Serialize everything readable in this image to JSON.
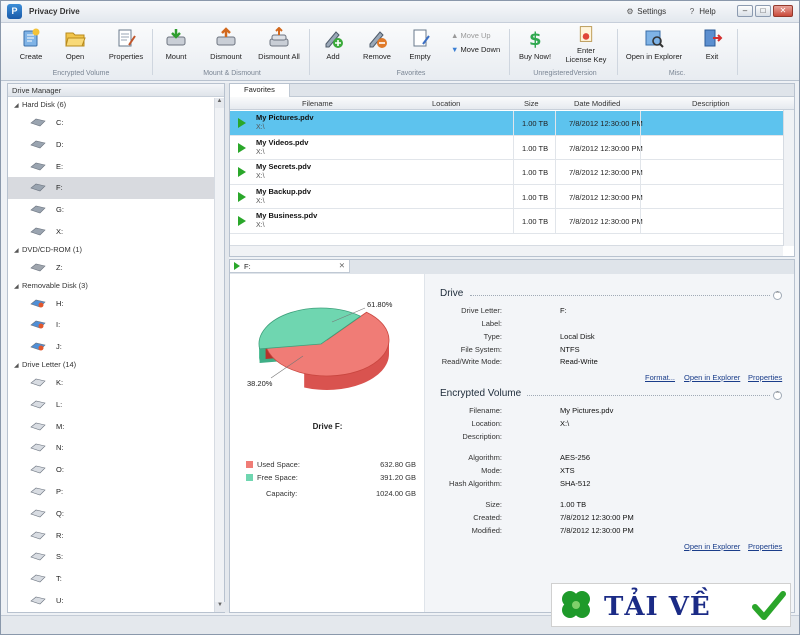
{
  "app": {
    "title": "Privacy Drive",
    "logo_letter": "P",
    "settings_label": "Settings",
    "help_label": "Help"
  },
  "ribbon": {
    "create": "Create",
    "open": "Open",
    "properties": "Properties",
    "group_encrypted": "Encrypted Volume",
    "mount": "Mount",
    "dismount": "Dismount",
    "dismount_all": "Dismount All",
    "group_mount": "Mount & Dismount",
    "add": "Add",
    "remove": "Remove",
    "empty": "Empty",
    "move_up": "Move Up",
    "move_down": "Move Down",
    "group_favorites": "Favorites",
    "buy_now": "Buy Now!",
    "enter_license_1": "Enter",
    "enter_license_2": "License Key",
    "group_unregistered": "UnregisteredVersion",
    "open_in_explorer": "Open in Explorer",
    "exit": "Exit",
    "group_misc": "Misc."
  },
  "drive_manager": {
    "header": "Drive Manager",
    "groups": [
      {
        "label": "Hard Disk (6)",
        "items": [
          "C:",
          "D:",
          "E:",
          "F:",
          "G:",
          "X:"
        ]
      },
      {
        "label": "DVD/CD-ROM (1)",
        "items": [
          "Z:"
        ]
      },
      {
        "label": "Removable Disk (3)",
        "items": [
          "H:",
          "I:",
          "J:"
        ]
      },
      {
        "label": "Drive Letter (14)",
        "items": [
          "K:",
          "L:",
          "M:",
          "N:",
          "O:",
          "P:",
          "Q:",
          "R:",
          "S:",
          "T:",
          "U:"
        ]
      }
    ],
    "selected": "F:"
  },
  "favorites": {
    "tab": "Favorites",
    "columns": {
      "filename": "Filename",
      "location": "Location",
      "size": "Size",
      "modified": "Date Modified",
      "description": "Description"
    },
    "rows": [
      {
        "name": "My Pictures.pdv",
        "loc": "X:\\",
        "size": "1.00 TB",
        "date": "7/8/2012 12:30:00 PM"
      },
      {
        "name": "My Videos.pdv",
        "loc": "X:\\",
        "size": "1.00 TB",
        "date": "7/8/2012 12:30:00 PM"
      },
      {
        "name": "My Secrets.pdv",
        "loc": "X:\\",
        "size": "1.00 TB",
        "date": "7/8/2012 12:30:00 PM"
      },
      {
        "name": "My Backup.pdv",
        "loc": "X:\\",
        "size": "1.00 TB",
        "date": "7/8/2012 12:30:00 PM"
      },
      {
        "name": "My Business.pdv",
        "loc": "X:\\",
        "size": "1.00 TB",
        "date": "7/8/2012 12:30:00 PM"
      }
    ]
  },
  "detail": {
    "tab": "F:",
    "chart": {
      "used_pct_label": "61.80%",
      "free_pct_label": "38.20%",
      "used_fraction": 0.618,
      "drive_label": "Drive F:",
      "used_label": "Used Space:",
      "used_value": "632.80 GB",
      "free_label": "Free Space:",
      "free_value": "391.20 GB",
      "capacity_label": "Capacity:",
      "capacity_value": "1024.00 GB",
      "used_color": "#f07c76",
      "free_color": "#6fd6b0"
    },
    "drive": {
      "title": "Drive",
      "letter_label": "Drive Letter:",
      "letter": "F:",
      "label_label": "Label:",
      "label": "",
      "type_label": "Type:",
      "type": "Local Disk",
      "fs_label": "File System:",
      "fs": "NTFS",
      "rw_label": "Read/Write Mode:",
      "rw": "Read-Write",
      "format_link": "Format...",
      "explorer_link": "Open in Explorer",
      "properties_link": "Properties"
    },
    "volume": {
      "title": "Encrypted Volume",
      "filename_label": "Filename:",
      "filename": "My Pictures.pdv",
      "location_label": "Location:",
      "location": "X:\\",
      "description_label": "Description:",
      "description": "",
      "algorithm_label": "Algorithm:",
      "algorithm": "AES-256",
      "mode_label": "Mode:",
      "mode": "XTS",
      "hash_label": "Hash Algorithm:",
      "hash": "SHA-512",
      "size_label": "Size:",
      "size": "1.00 TB",
      "created_label": "Created:",
      "created": "7/8/2012 12:30:00 PM",
      "modified_label": "Modified:",
      "modified": "7/8/2012 12:30:00 PM",
      "explorer_link": "Open in Explorer",
      "properties_link": "Properties"
    }
  },
  "watermark": {
    "text": "TẢI VỀ"
  }
}
